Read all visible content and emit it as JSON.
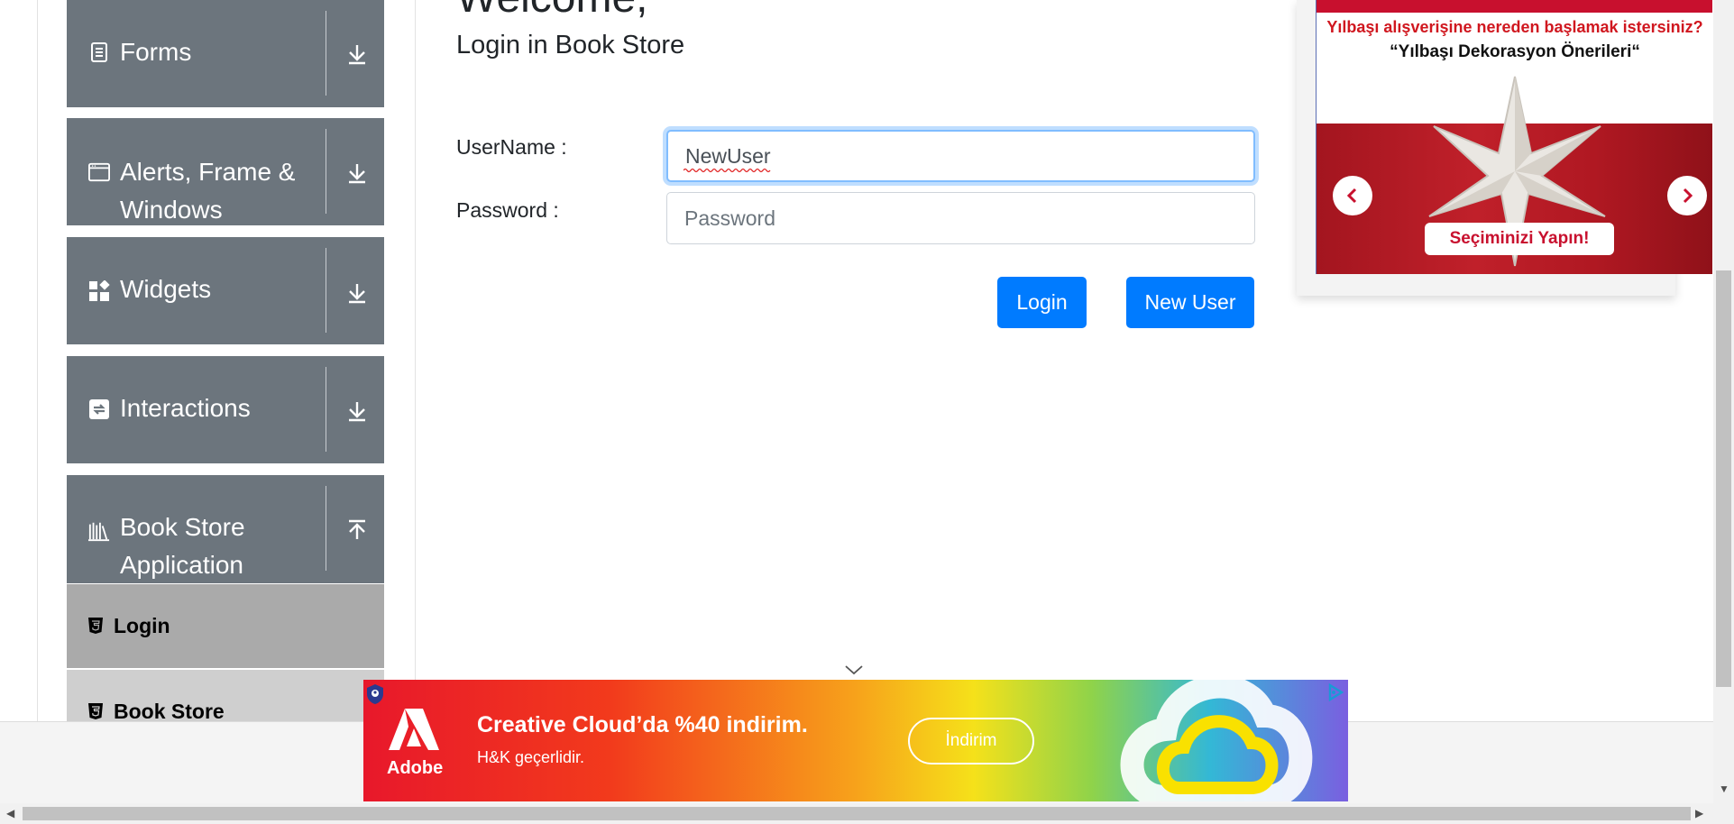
{
  "sidebar": {
    "groups": [
      {
        "label": "Forms",
        "icon": "form-icon"
      },
      {
        "label": "Alerts, Frame &",
        "label2": "Windows",
        "icon": "window-icon"
      },
      {
        "label": "Widgets",
        "icon": "widgets-icon"
      },
      {
        "label": "Interactions",
        "icon": "interactions-icon"
      },
      {
        "label": "Book Store",
        "label2": "Application",
        "icon": "bookshelf-icon"
      }
    ],
    "subitems": [
      {
        "label": "Login",
        "icon": "html5-icon"
      },
      {
        "label": "Book Store",
        "icon": "html5-icon"
      }
    ]
  },
  "main": {
    "welcome": "Welcome,",
    "subtitle": "Login in Book Store",
    "username_label": "UserName :",
    "username_value": "NewUser",
    "password_label": "Password :",
    "password_placeholder": "Password",
    "login_button": "Login",
    "new_user_button": "New User"
  },
  "ad_right": {
    "question": "Yılbaşı alışverişine nereden başlamak istersiniz?",
    "title": "“Yılbaşı Dekorasyon Önerileri“",
    "cta": "Seçiminizi Yapın!"
  },
  "banner": {
    "brand": "Adobe",
    "headline": "Creative Cloud’da %40 indirim.",
    "subline": "H&K geçerlidir.",
    "button": "İndirim"
  },
  "colors": {
    "sidebar_bg": "#6c757d",
    "primary_button": "#007bff",
    "sub_active": "#aaaaaa",
    "sub_inactive": "#cfcfcf"
  }
}
